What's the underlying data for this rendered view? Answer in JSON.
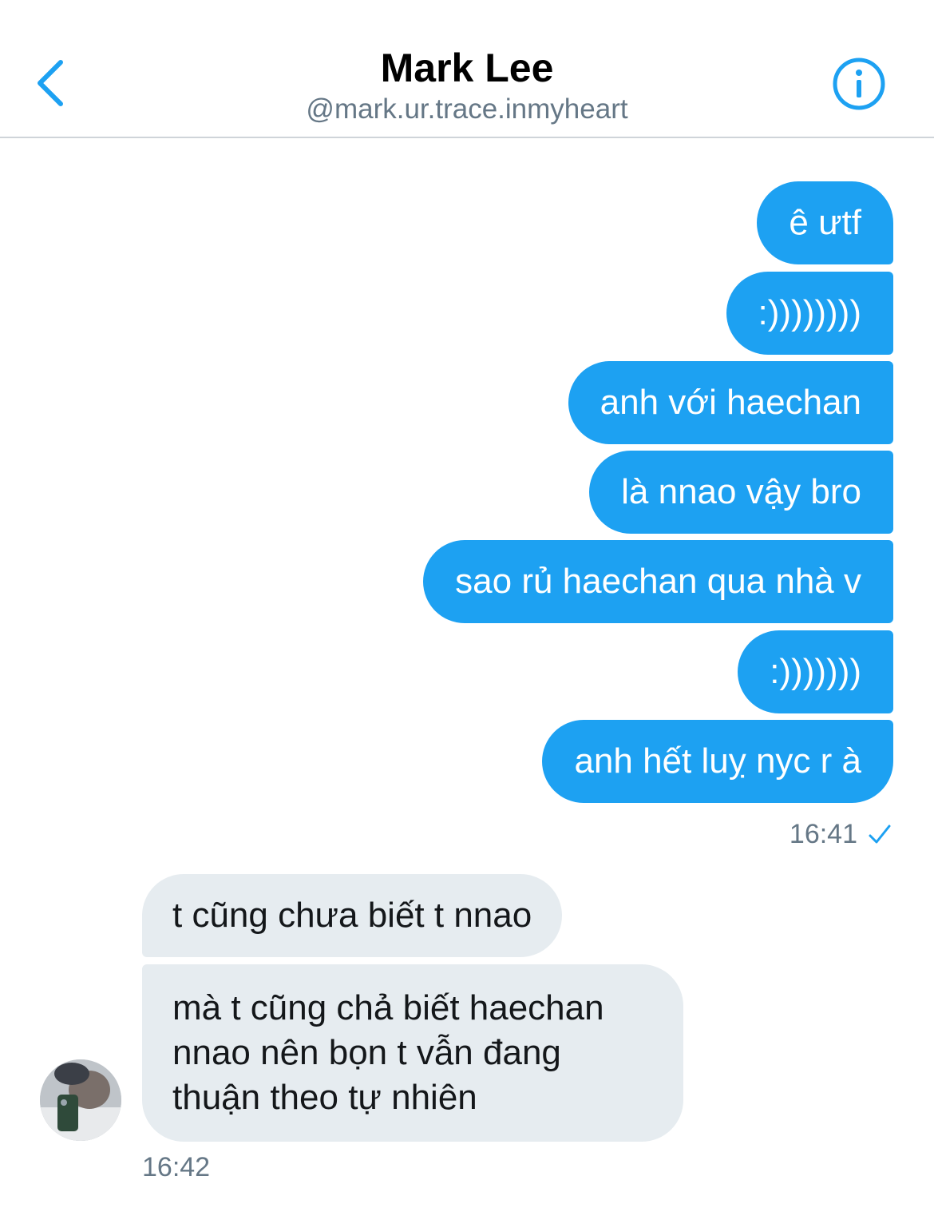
{
  "header": {
    "title": "Mark Lee",
    "handle": "@mark.ur.trace.inmyheart",
    "back_icon": "chevron-left-icon",
    "info_icon": "info-icon"
  },
  "colors": {
    "accent": "#1da1f2",
    "incoming_bubble": "#e6ecf0",
    "meta_text": "#657786"
  },
  "messages_out": [
    "ê ưtf",
    ":))))))))",
    "anh với haechan",
    "là nnao vậy bro",
    "sao rủ haechan qua nhà v",
    ":)))))))",
    "anh hết luỵ nyc r à"
  ],
  "out_time": "16:41",
  "out_status_icon": "checkmark-icon",
  "messages_in": [
    "t cũng chưa biết t nnao",
    "mà t cũng chả biết haechan nnao nên bọn t vẫn đang thuận theo tự nhiên"
  ],
  "in_time": "16:42"
}
